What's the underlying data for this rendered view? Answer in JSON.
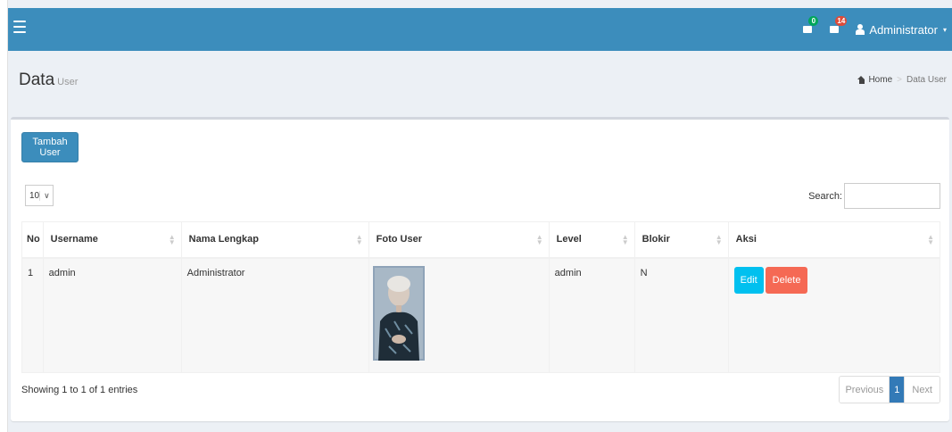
{
  "navbar": {
    "notifications_count": "0",
    "messages_count": "14",
    "user_name": "Administrator",
    "colors": {
      "bar": "#3c8dbc",
      "badge_green": "#00a65a",
      "badge_red": "#dd4b39"
    },
    "icons": [
      "menu-icon",
      "envelope-icon",
      "message-icon",
      "user-icon",
      "caret-down-icon"
    ]
  },
  "header": {
    "title": "Data",
    "subtitle": "User",
    "breadcrumb": {
      "home": "Home",
      "separator": ">",
      "current": "Data User"
    }
  },
  "toolbar": {
    "add_button": "Tambah User",
    "page_length": "10",
    "search_label": "Search:",
    "search_value": ""
  },
  "table": {
    "columns": [
      "No",
      "Username",
      "Nama Lengkap",
      "Foto User",
      "Level",
      "Blokir",
      "Aksi"
    ],
    "rows": [
      {
        "no": "1",
        "username": "admin",
        "nama_lengkap": "Administrator",
        "foto": "user-photo",
        "level": "admin",
        "blokir": "N",
        "actions": {
          "edit": "Edit",
          "delete": "Delete"
        }
      }
    ]
  },
  "footer": {
    "info": "Showing 1 to 1 of 1 entries",
    "pagination": {
      "previous": "Previous",
      "current": "1",
      "next": "Next"
    }
  }
}
